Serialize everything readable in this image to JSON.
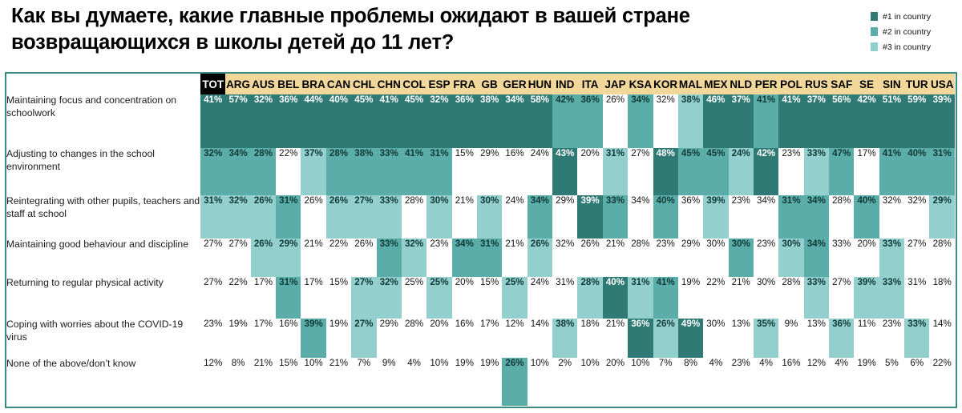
{
  "title": "Как вы думаете, какие главные проблемы ожидают в вашей стране возвращающихся в школы детей до 11 лет?",
  "legend": {
    "items": [
      {
        "label": "#1 in country",
        "color": "#2f7a74",
        "icon": "legend-swatch"
      },
      {
        "label": "#2  in country",
        "color": "#5aada8",
        "icon": "legend-swatch"
      },
      {
        "label": "#3  in country",
        "color": "#93d0cd",
        "icon": "legend-swatch"
      }
    ]
  },
  "colors": {
    "rank1": "#2f7a74",
    "rank2": "#5aada8",
    "rank3": "#93d0cd",
    "none": "#ffffff",
    "header_bg": "#f2d79b",
    "total_bg": "#000000",
    "frame": "#3c8a86"
  },
  "chart_data": {
    "type": "heatmap",
    "title": "Как вы думаете, какие главные проблемы ожидают в вашей стране возвращающихся в школы детей до 11 лет?",
    "xlabel": "",
    "ylabel": "",
    "legend_position": "top-right",
    "columns": [
      "TOT",
      "ARG",
      "AUS",
      "BEL",
      "BRA",
      "CAN",
      "CHL",
      "CHN",
      "COL",
      "ESP",
      "FRA",
      "GB",
      "GER",
      "HUN",
      "IND",
      "ITA",
      "JAP",
      "KSA",
      "KOR",
      "MAL",
      "MEX",
      "NLD",
      "PER",
      "POL",
      "RUS",
      "SAF",
      "SE",
      "SIN",
      "TUR",
      "USA"
    ],
    "rows": [
      {
        "label": "Maintaining focus and concentration on schoolwork",
        "values": [
          "41%",
          "57%",
          "32%",
          "36%",
          "44%",
          "40%",
          "45%",
          "41%",
          "45%",
          "32%",
          "36%",
          "38%",
          "34%",
          "58%",
          "42%",
          "36%",
          "26%",
          "34%",
          "32%",
          "38%",
          "46%",
          "37%",
          "41%",
          "41%",
          "37%",
          "56%",
          "42%",
          "51%",
          "59%",
          "39%"
        ],
        "ranks": [
          1,
          1,
          1,
          1,
          1,
          1,
          1,
          1,
          1,
          1,
          1,
          1,
          1,
          1,
          2,
          2,
          0,
          2,
          0,
          3,
          1,
          1,
          2,
          1,
          1,
          1,
          1,
          1,
          1,
          1
        ]
      },
      {
        "label": "Adjusting to changes in the school environment",
        "values": [
          "32%",
          "34%",
          "28%",
          "22%",
          "37%",
          "28%",
          "38%",
          "33%",
          "41%",
          "31%",
          "15%",
          "29%",
          "16%",
          "24%",
          "43%",
          "20%",
          "31%",
          "27%",
          "48%",
          "45%",
          "45%",
          "24%",
          "42%",
          "23%",
          "33%",
          "47%",
          "17%",
          "41%",
          "40%",
          "31%"
        ],
        "ranks": [
          2,
          2,
          2,
          0,
          3,
          2,
          2,
          2,
          2,
          2,
          0,
          0,
          0,
          0,
          1,
          0,
          3,
          0,
          1,
          2,
          2,
          3,
          1,
          0,
          3,
          2,
          0,
          2,
          2,
          2
        ]
      },
      {
        "label": "Reintegrating with other pupils, teachers and staff at school",
        "values": [
          "31%",
          "32%",
          "26%",
          "31%",
          "26%",
          "26%",
          "27%",
          "33%",
          "28%",
          "30%",
          "21%",
          "30%",
          "24%",
          "34%",
          "29%",
          "39%",
          "33%",
          "34%",
          "40%",
          "36%",
          "39%",
          "23%",
          "34%",
          "31%",
          "34%",
          "28%",
          "40%",
          "32%",
          "32%",
          "29%"
        ],
        "ranks": [
          3,
          3,
          3,
          2,
          0,
          3,
          3,
          3,
          0,
          3,
          0,
          3,
          0,
          2,
          0,
          1,
          2,
          0,
          2,
          0,
          3,
          0,
          0,
          2,
          2,
          0,
          2,
          0,
          0,
          3
        ]
      },
      {
        "label": "Maintaining good behaviour and discipline",
        "values": [
          "27%",
          "27%",
          "26%",
          "29%",
          "21%",
          "22%",
          "26%",
          "33%",
          "32%",
          "23%",
          "34%",
          "31%",
          "21%",
          "26%",
          "32%",
          "26%",
          "21%",
          "28%",
          "23%",
          "29%",
          "30%",
          "30%",
          "23%",
          "30%",
          "34%",
          "33%",
          "20%",
          "33%",
          "27%",
          "28%"
        ],
        "ranks": [
          0,
          0,
          3,
          3,
          0,
          0,
          0,
          2,
          3,
          0,
          2,
          2,
          0,
          3,
          0,
          0,
          0,
          0,
          0,
          0,
          0,
          2,
          0,
          3,
          2,
          0,
          0,
          3,
          0,
          0
        ]
      },
      {
        "label": "Returning to regular physical activity",
        "values": [
          "27%",
          "22%",
          "17%",
          "31%",
          "17%",
          "15%",
          "27%",
          "32%",
          "25%",
          "25%",
          "20%",
          "15%",
          "25%",
          "24%",
          "31%",
          "28%",
          "40%",
          "31%",
          "41%",
          "19%",
          "22%",
          "21%",
          "30%",
          "28%",
          "33%",
          "27%",
          "39%",
          "33%",
          "31%",
          "18%"
        ],
        "ranks": [
          0,
          0,
          0,
          2,
          0,
          0,
          3,
          3,
          0,
          3,
          0,
          0,
          3,
          0,
          0,
          3,
          1,
          3,
          2,
          0,
          0,
          0,
          0,
          0,
          3,
          0,
          3,
          3,
          0,
          0
        ]
      },
      {
        "label": "Coping with worries about the COVID-19 virus",
        "values": [
          "23%",
          "19%",
          "17%",
          "16%",
          "39%",
          "19%",
          "27%",
          "29%",
          "28%",
          "20%",
          "16%",
          "17%",
          "12%",
          "14%",
          "38%",
          "18%",
          "21%",
          "36%",
          "26%",
          "49%",
          "30%",
          "13%",
          "35%",
          "9%",
          "13%",
          "36%",
          "11%",
          "23%",
          "33%",
          "14%"
        ],
        "ranks": [
          0,
          0,
          0,
          0,
          2,
          0,
          3,
          0,
          0,
          0,
          0,
          0,
          0,
          0,
          3,
          0,
          0,
          1,
          3,
          1,
          0,
          0,
          3,
          0,
          0,
          3,
          0,
          0,
          3,
          0
        ]
      },
      {
        "label": "None of the above/don’t know",
        "values": [
          "12%",
          "8%",
          "21%",
          "15%",
          "10%",
          "21%",
          "7%",
          "9%",
          "4%",
          "10%",
          "19%",
          "19%",
          "26%",
          "10%",
          "2%",
          "10%",
          "20%",
          "10%",
          "7%",
          "8%",
          "4%",
          "23%",
          "4%",
          "16%",
          "12%",
          "4%",
          "19%",
          "5%",
          "6%",
          "22%"
        ],
        "ranks": [
          0,
          0,
          0,
          0,
          0,
          0,
          0,
          0,
          0,
          0,
          0,
          0,
          2,
          0,
          0,
          0,
          0,
          0,
          0,
          0,
          0,
          0,
          0,
          0,
          0,
          0,
          0,
          0,
          0,
          0
        ]
      }
    ]
  }
}
